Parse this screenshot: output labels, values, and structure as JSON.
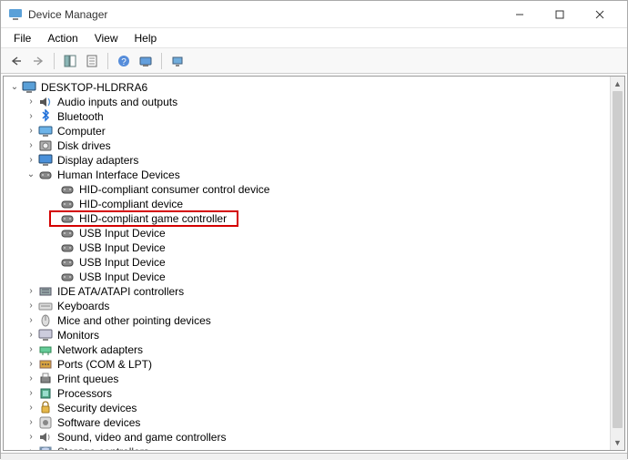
{
  "window": {
    "title": "Device Manager"
  },
  "menu": {
    "file": "File",
    "action": "Action",
    "view": "View",
    "help": "Help"
  },
  "tree": {
    "root": "DESKTOP-HLDRRA6",
    "categories": [
      {
        "label": "Audio inputs and outputs",
        "icon": "audio",
        "expanded": false
      },
      {
        "label": "Bluetooth",
        "icon": "bluetooth",
        "expanded": false
      },
      {
        "label": "Computer",
        "icon": "computer",
        "expanded": false
      },
      {
        "label": "Disk drives",
        "icon": "disk",
        "expanded": false
      },
      {
        "label": "Display adapters",
        "icon": "display",
        "expanded": false
      },
      {
        "label": "Human Interface Devices",
        "icon": "hid",
        "expanded": true,
        "children": [
          {
            "label": "HID-compliant consumer control device"
          },
          {
            "label": "HID-compliant device"
          },
          {
            "label": "HID-compliant game controller",
            "highlighted": true
          },
          {
            "label": "USB Input Device"
          },
          {
            "label": "USB Input Device"
          },
          {
            "label": "USB Input Device"
          },
          {
            "label": "USB Input Device"
          }
        ]
      },
      {
        "label": "IDE ATA/ATAPI controllers",
        "icon": "ide",
        "expanded": false
      },
      {
        "label": "Keyboards",
        "icon": "keyboard",
        "expanded": false
      },
      {
        "label": "Mice and other pointing devices",
        "icon": "mouse",
        "expanded": false
      },
      {
        "label": "Monitors",
        "icon": "monitor",
        "expanded": false
      },
      {
        "label": "Network adapters",
        "icon": "network",
        "expanded": false
      },
      {
        "label": "Ports (COM & LPT)",
        "icon": "ports",
        "expanded": false
      },
      {
        "label": "Print queues",
        "icon": "print",
        "expanded": false
      },
      {
        "label": "Processors",
        "icon": "processor",
        "expanded": false
      },
      {
        "label": "Security devices",
        "icon": "security",
        "expanded": false
      },
      {
        "label": "Software devices",
        "icon": "software",
        "expanded": false
      },
      {
        "label": "Sound, video and game controllers",
        "icon": "sound",
        "expanded": false
      },
      {
        "label": "Storage controllers",
        "icon": "storage",
        "expanded": false,
        "cutoff": true
      }
    ]
  }
}
